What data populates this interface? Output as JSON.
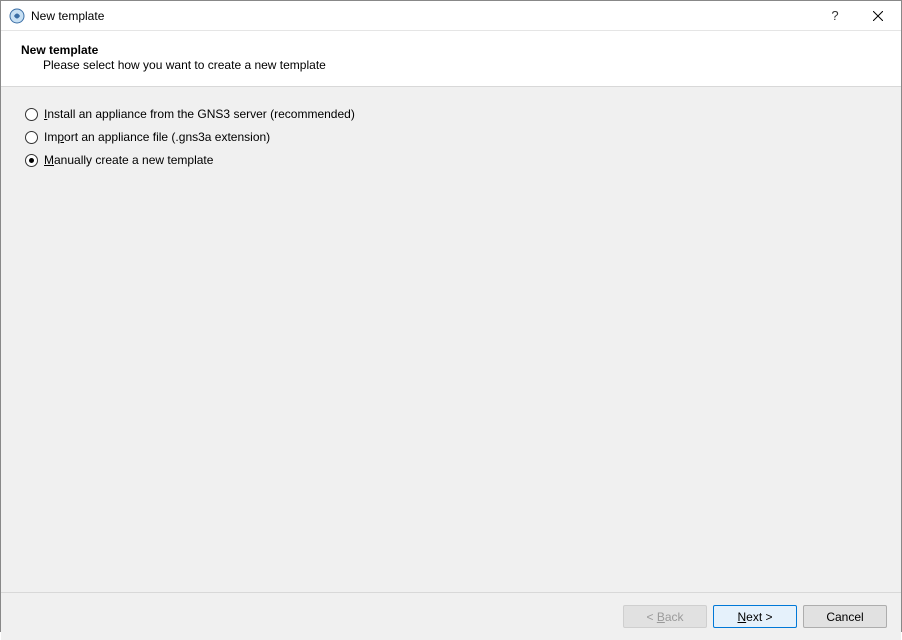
{
  "window": {
    "title": "New template"
  },
  "header": {
    "title": "New template",
    "subtitle": "Please select how you want to create a new template"
  },
  "options": {
    "install": {
      "accel": "I",
      "rest": "nstall an appliance from the GNS3 server (recommended)",
      "selected": false
    },
    "import": {
      "prefix": "Im",
      "accel": "p",
      "rest": "ort an appliance file (.gns3a extension)",
      "selected": false
    },
    "manual": {
      "accel": "M",
      "rest": "anually create a new template",
      "selected": true
    }
  },
  "buttons": {
    "back": {
      "lt": "< ",
      "accel": "B",
      "rest": "ack"
    },
    "next": {
      "accel": "N",
      "rest": "ext >"
    },
    "cancel": "Cancel"
  }
}
